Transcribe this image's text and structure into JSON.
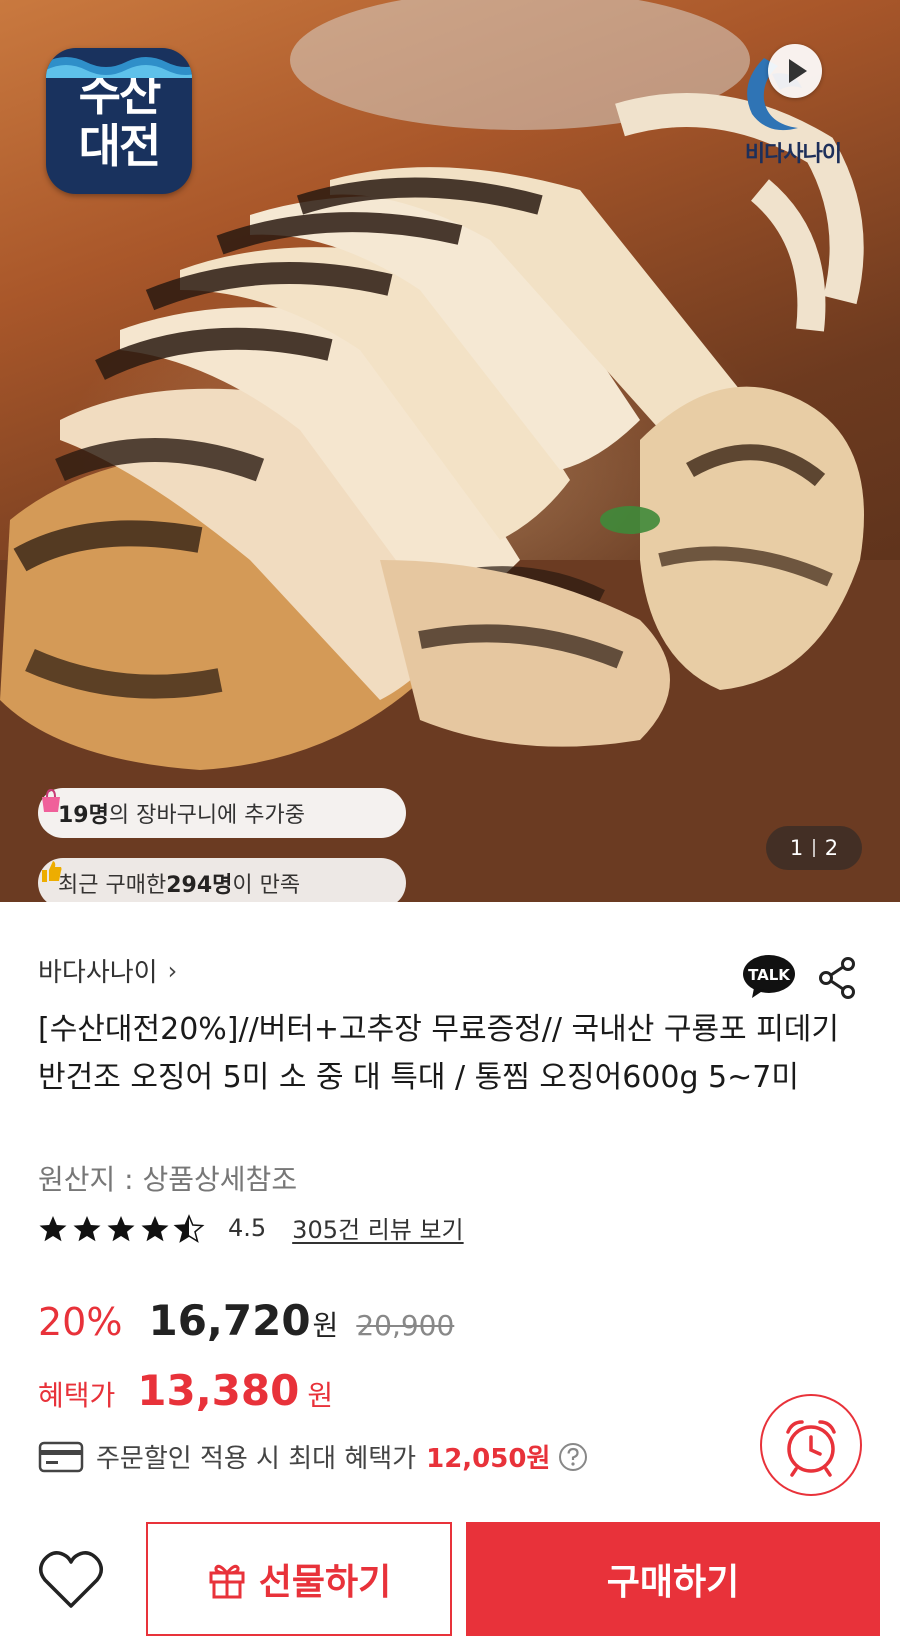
{
  "hero": {
    "logo_line1": "수산",
    "logo_line2": "대전",
    "brand_text": "비다사나이",
    "pill_cart_count": "19명",
    "pill_cart_text": "의 장바구니에 추가중",
    "pill_recent_text": "최근 구매한 ",
    "pill_recent_count": "294명",
    "pill_recent_suffix": "이 만족",
    "page_current": "1",
    "page_total": "2"
  },
  "product": {
    "seller": "바다사나이",
    "talk_label": "TALK",
    "title": "[수산대전20%]//버터+고추장 무료증정// 국내산 구룡포 피데기 반건조 오징어 5미 소 중 대 특대 / 통찜 오징어600g 5~7미",
    "origin": "원산지 : 상품상세참조",
    "rating_value": "4.5",
    "rating_stars": 4.5,
    "reviews_link": "305건 리뷰 보기"
  },
  "price": {
    "discount": "20%",
    "sale_price": "16,720",
    "currency": "원",
    "original_price": "20,900",
    "benefit_label": "혜택가",
    "benefit_price": "13,380",
    "coupon_text": "주문할인 적용 시 최대 혜택가",
    "coupon_max": "12,050원"
  },
  "bottom_bar": {
    "gift_label": "선물하기",
    "buy_label": "구매하기"
  },
  "colors": {
    "accent": "#e8323a",
    "logo_bg": "#19325e"
  }
}
